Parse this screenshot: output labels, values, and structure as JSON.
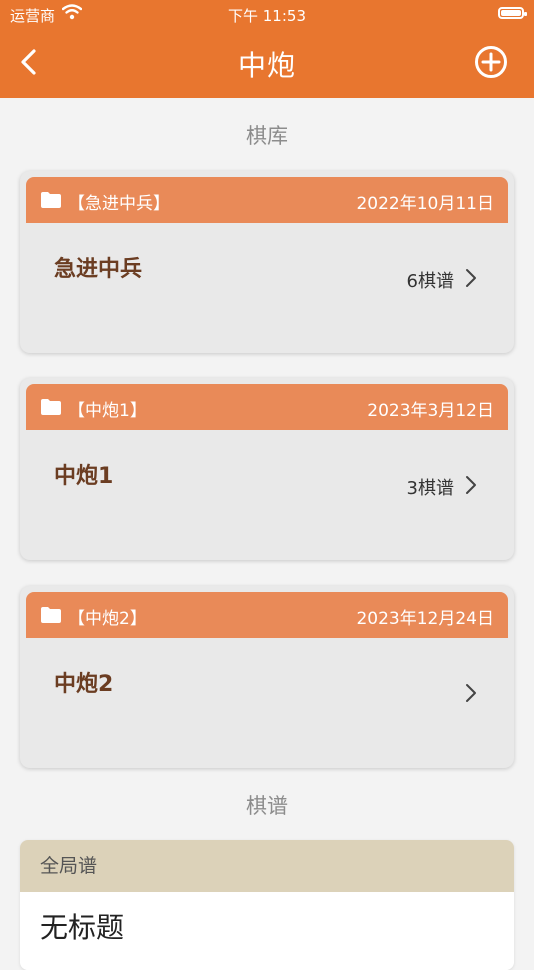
{
  "status_bar": {
    "carrier": "运营商",
    "time": "下午 11:53"
  },
  "nav": {
    "title": "中炮"
  },
  "library": {
    "section_title": "棋库",
    "cards": [
      {
        "tag": "【急进中兵】",
        "date": "2022年10月11日",
        "name": "急进中兵",
        "count": "6棋谱"
      },
      {
        "tag": "【中炮1】",
        "date": "2023年3月12日",
        "name": "中炮1",
        "count": "3棋谱"
      },
      {
        "tag": "【中炮2】",
        "date": "2023年12月24日",
        "name": "中炮2",
        "count": ""
      }
    ]
  },
  "games": {
    "section_title": "棋谱",
    "group_header": "全局谱",
    "items": [
      {
        "title": "无标题"
      }
    ]
  },
  "colors": {
    "accent": "#e8762f",
    "card_header": "#e98a58",
    "card_name": "#6b3d22",
    "group_header_bg": "#dcd2b9"
  }
}
